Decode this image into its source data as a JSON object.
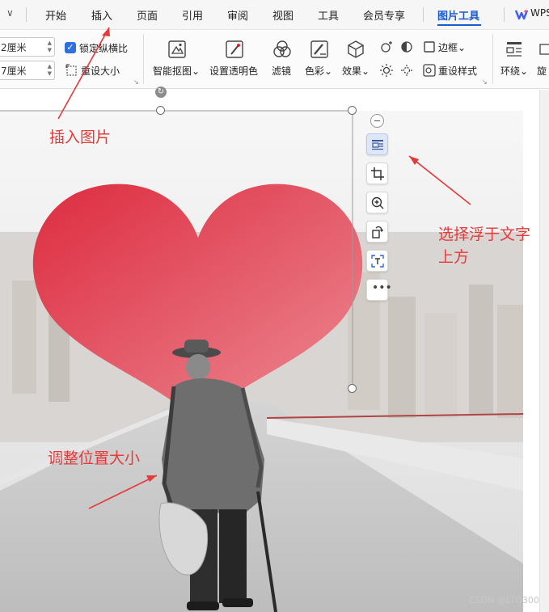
{
  "menu": {
    "tabs": [
      "开始",
      "插入",
      "页面",
      "引用",
      "审阅",
      "视图",
      "工具",
      "会员专享",
      "图片工具"
    ],
    "active_tab": "图片工具",
    "wps_label": "WPS",
    "accent_color": "#1a5bd1"
  },
  "ribbon": {
    "width_value": "2厘米",
    "height_value": "7厘米",
    "lock_ratio_label": "锁定纵横比",
    "lock_ratio_checked": true,
    "reset_size_label": "重设大小",
    "buttons": [
      {
        "label": "智能抠图",
        "icon": "smart-cutout-icon",
        "dropdown": true
      },
      {
        "label": "设置透明色",
        "icon": "transparent-color-icon",
        "dropdown": false
      },
      {
        "label": "滤镜",
        "icon": "filter-icon",
        "dropdown": false
      },
      {
        "label": "色彩",
        "icon": "color-icon",
        "dropdown": true
      },
      {
        "label": "效果",
        "icon": "effect-icon",
        "dropdown": true
      }
    ],
    "border_label": "边框",
    "reset_style_label": "重设样式",
    "wrap_label": "环绕",
    "rotate_label": "旋"
  },
  "float_toolbar": {
    "buttons": [
      "wrap-text-icon",
      "crop-icon",
      "zoom-in-icon",
      "rotate-icon",
      "extract-text-icon",
      "more-icon"
    ],
    "selected": "wrap-text-icon"
  },
  "annotations": {
    "insert_picture": "插入图片",
    "float_above_text_line1": "选择浮于文字",
    "float_above_text_line2": "上方",
    "adjust_size": "调整位置大小",
    "color": "#e5393a"
  },
  "watermark": "CSDN @LTQ300"
}
